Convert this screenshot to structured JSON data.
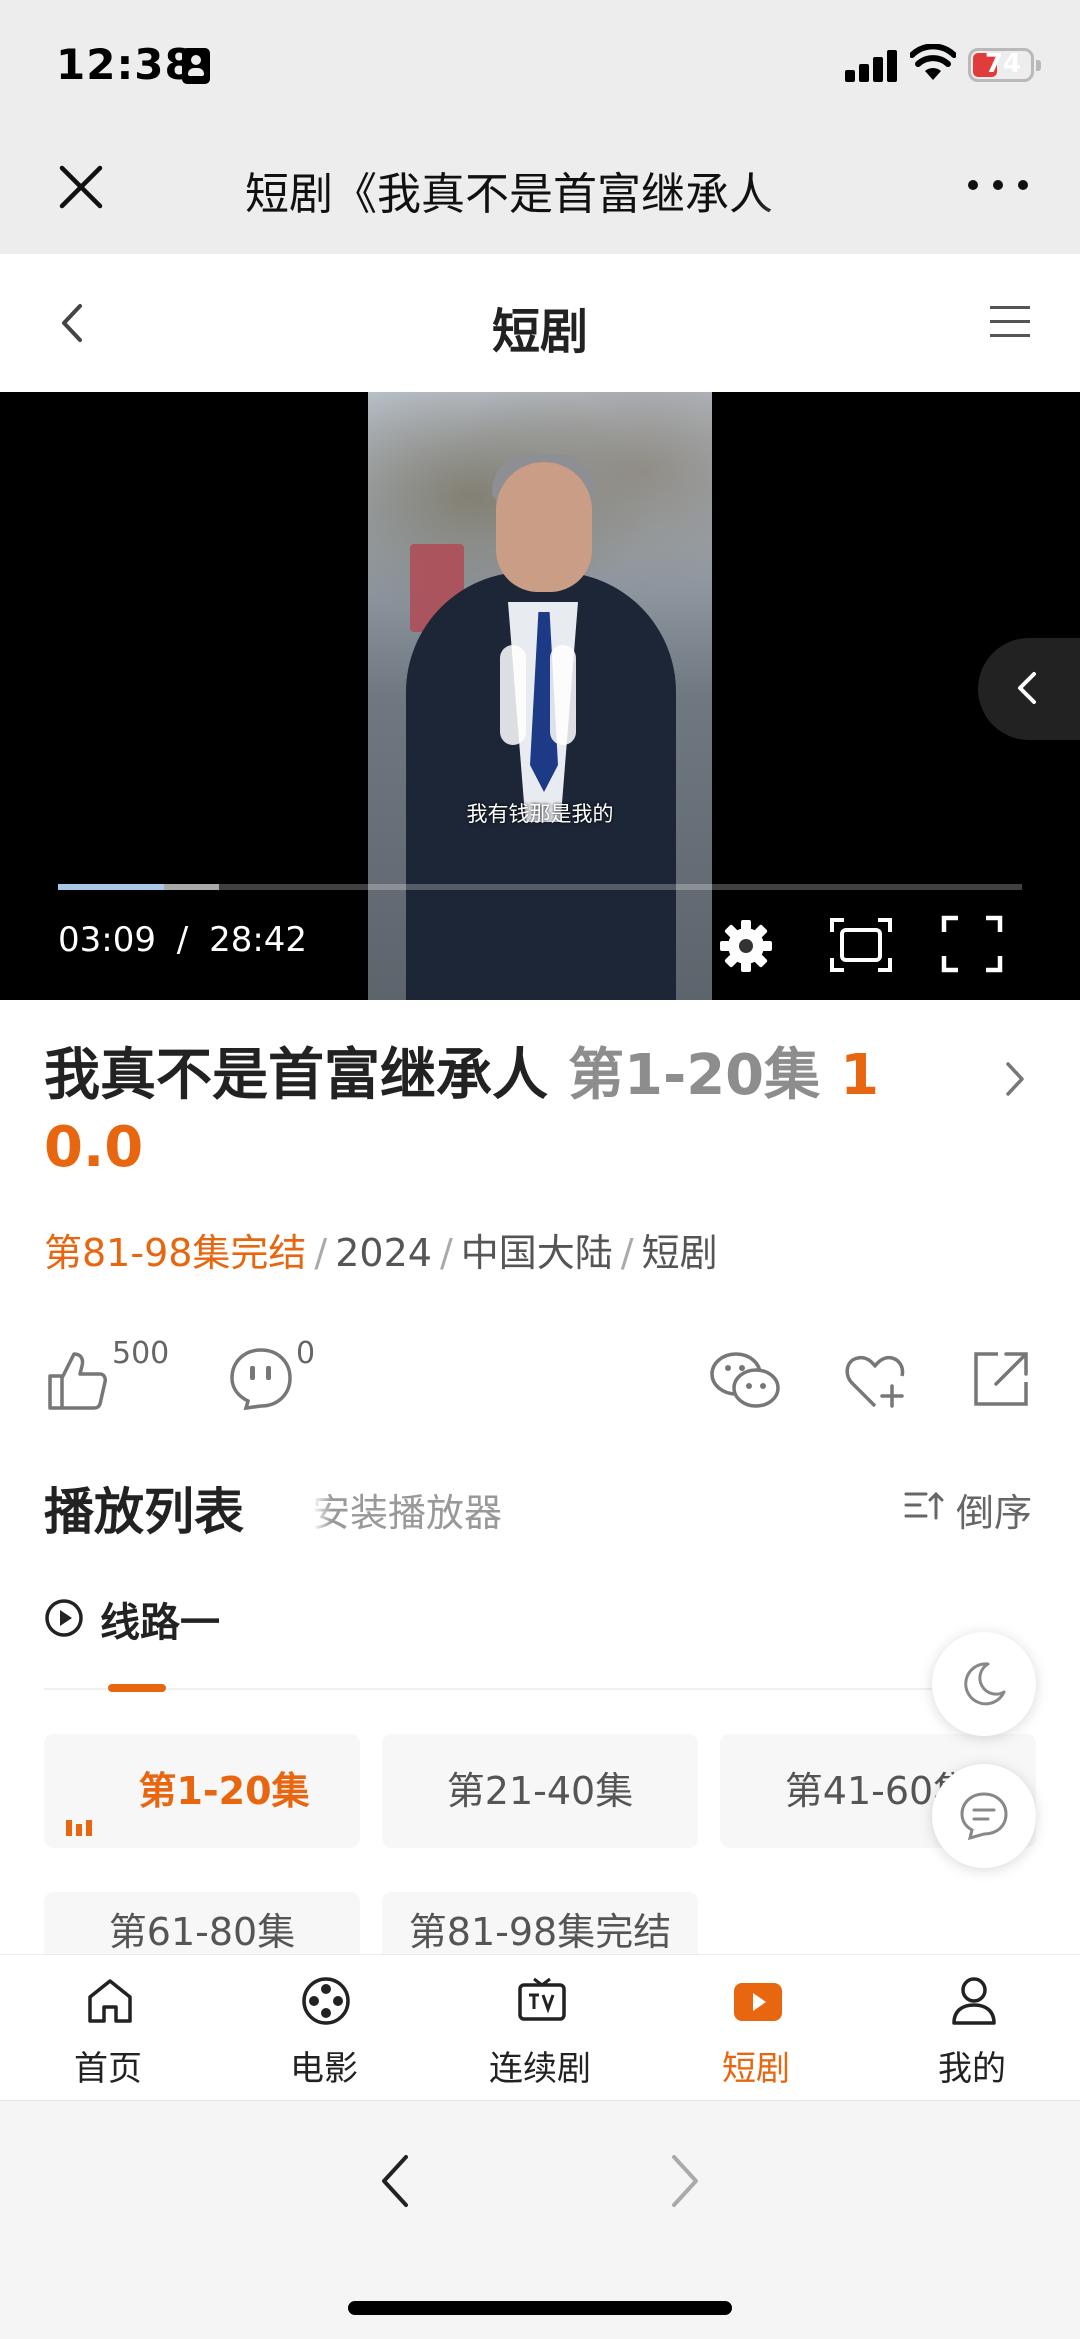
{
  "status_bar": {
    "time": "12:38",
    "battery": "74"
  },
  "wechat": {
    "title": "短剧《我真不是首富继承人"
  },
  "site": {
    "title": "短剧"
  },
  "video": {
    "subtitle": "我有钱那是我的",
    "current_time": "03:09",
    "duration": "28:42",
    "time_separator": "/",
    "played_fraction": 0.11,
    "buffered_fraction": 0.167
  },
  "show": {
    "title": "我真不是首富继承人",
    "episodes": "第1-20集",
    "score_line1": "1",
    "score_line2": "0.0",
    "status": "第81-98集完结",
    "year": "2024",
    "region": "中国大陆",
    "genre": "短剧",
    "separator": "/"
  },
  "actions": {
    "likes": "500",
    "comments": "0"
  },
  "playlist": {
    "title": "播放列表",
    "hint": "安装播放器",
    "sort_label": "倒序",
    "route": "线路一",
    "episodes": [
      "第1-20集",
      "第21-40集",
      "第41-60集",
      "第61-80集",
      "第81-98集完结"
    ]
  },
  "tabs": [
    {
      "label": "首页",
      "icon": "home-icon"
    },
    {
      "label": "电影",
      "icon": "film-reel-icon"
    },
    {
      "label": "连续剧",
      "icon": "tv-icon"
    },
    {
      "label": "短剧",
      "icon": "play-box-icon"
    },
    {
      "label": "我的",
      "icon": "user-icon"
    }
  ],
  "colors": {
    "accent": "#e8660f",
    "progress": "#a9c7e8"
  }
}
